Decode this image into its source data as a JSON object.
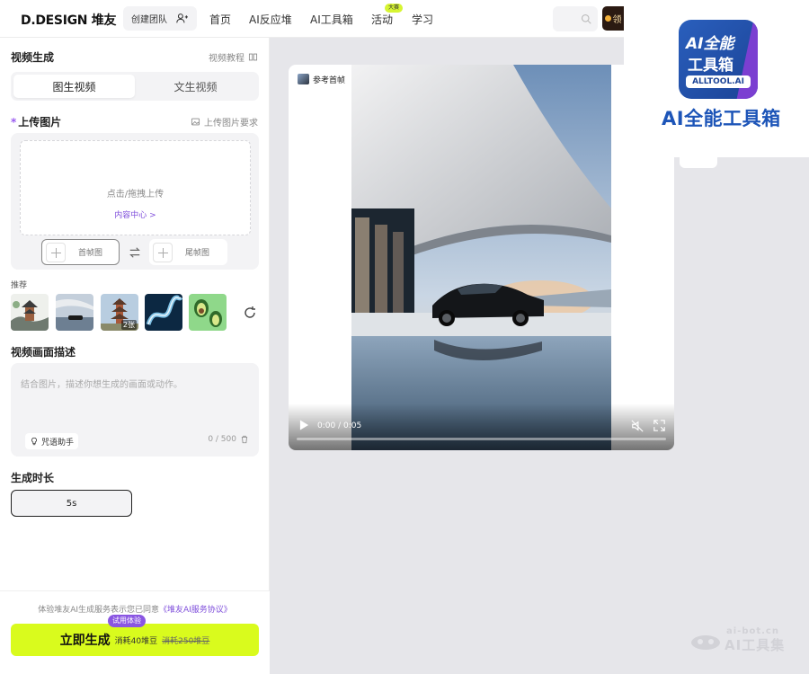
{
  "header": {
    "logo": "D.DESIGN 堆友",
    "team_button": "创建团队",
    "nav": [
      "首页",
      "AI反应堆",
      "AI工具箱",
      "活动",
      "学习"
    ],
    "nav_badge": "大赛",
    "coupon_label": "领"
  },
  "panel": {
    "title": "视频生成",
    "tutorial_link": "视频教程",
    "tabs": [
      {
        "label": "图生视频",
        "active": true
      },
      {
        "label": "文生视频",
        "active": false
      }
    ],
    "upload_title": "上传图片",
    "required_mark": "*",
    "upload_req_link": "上传图片要求",
    "dropzone_text": "点击/拖拽上传",
    "content_center_link": "内容中心 >",
    "first_frame": "首帧图",
    "last_frame": "尾帧图",
    "recommend_label": "推荐",
    "recommend_thumbs": [
      {
        "name": "pagoda-ink"
      },
      {
        "name": "car-pavilion"
      },
      {
        "name": "pagoda-tower",
        "tag": "2张"
      },
      {
        "name": "dragon-blue"
      },
      {
        "name": "avocado"
      }
    ],
    "desc_title": "视频画面描述",
    "desc_placeholder": "结合图片，描述你想生成的画面或动作。",
    "helper_label": "咒语助手",
    "char_count": "0 / 500",
    "duration_title": "生成时长",
    "duration_value": "5s"
  },
  "footer": {
    "agree_prefix": "体验堆友AI生成服务表示您已同意",
    "agree_link": "《堆友AI服务协议》",
    "trial_badge": "试用体验",
    "generate_label": "立即生成",
    "cost": "消耗40堆豆",
    "cost_original": "消耗250堆豆"
  },
  "video": {
    "ref_tag": "参考首帧",
    "time": "0:00 / 0:05",
    "progress": 0
  },
  "overlay_logo": {
    "line1": "AI全能",
    "line2": "工具箱",
    "pill": "ALLTOOL.AI",
    "text": "AI全能工具箱"
  },
  "watermark": {
    "url": "ai-bot.cn",
    "name": "AI工具集"
  },
  "colors": {
    "accent_purple": "#7e4ddb",
    "generate_green": "#d9fb1d",
    "badge_yellow": "#d7f532",
    "logo_blue": "#1d55b8"
  }
}
